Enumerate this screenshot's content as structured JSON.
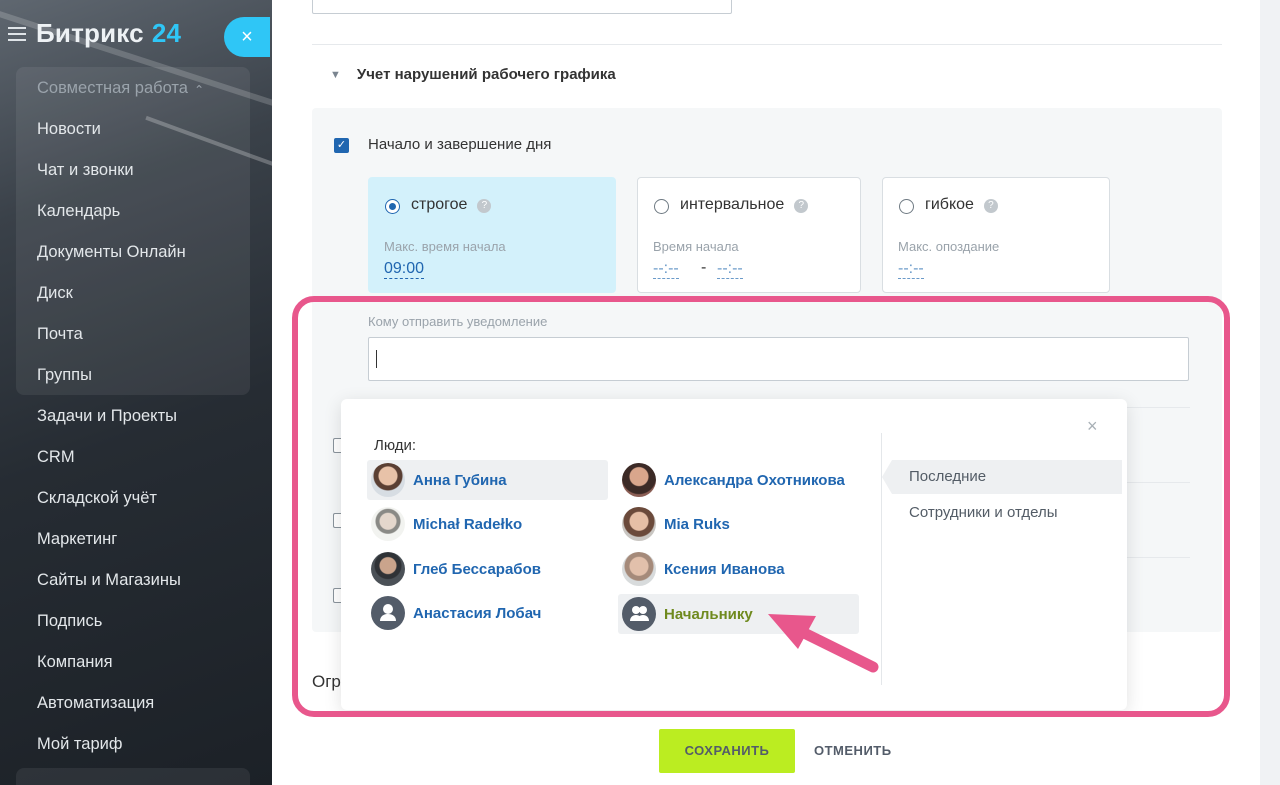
{
  "sidebar": {
    "logo": "Битрикс",
    "logo_num": "24",
    "close_icon": "×",
    "group_title": "Совместная работа",
    "items": [
      {
        "label": "Новости"
      },
      {
        "label": "Чат и звонки"
      },
      {
        "label": "Календарь"
      },
      {
        "label": "Документы Онлайн"
      },
      {
        "label": "Диск"
      },
      {
        "label": "Почта"
      },
      {
        "label": "Группы"
      },
      {
        "label": "Задачи и Проекты"
      },
      {
        "label": "CRM"
      },
      {
        "label": "Складской учёт"
      },
      {
        "label": "Маркетинг"
      },
      {
        "label": "Сайты и Магазины"
      },
      {
        "label": "Подпись"
      },
      {
        "label": "Компания"
      },
      {
        "label": "Автоматизация"
      },
      {
        "label": "Мой тариф"
      }
    ]
  },
  "section": {
    "title": "Учет нарушений рабочего графика",
    "day_checkbox_label": "Начало и завершение дня",
    "modes": [
      {
        "name": "строгое",
        "sub": "Макс. время начала",
        "value": "09:00",
        "selected": true
      },
      {
        "name": "интервальное",
        "sub": "Время начала",
        "from": "--:--",
        "sep": "-",
        "to": "--:--",
        "selected": false
      },
      {
        "name": "гибкое",
        "sub": "Макс. опоздание",
        "value": "--:--",
        "selected": false
      }
    ],
    "notify_label": "Кому отправить уведомление",
    "notify_value": "",
    "partial_text": "Огр"
  },
  "popup": {
    "close_icon": "×",
    "people_label": "Люди:",
    "people": [
      {
        "name": "Анна Губина",
        "avatar": "photo-avatar"
      },
      {
        "name": "Александра Охотникова",
        "avatar": "photo-avatar"
      },
      {
        "name": "Michał Radełko",
        "avatar": "photo-avatar"
      },
      {
        "name": "Mia Ruks",
        "avatar": "photo-avatar"
      },
      {
        "name": "Глеб Бессарабов",
        "avatar": "photo-avatar"
      },
      {
        "name": "Ксения Иванова",
        "avatar": "photo-avatar"
      },
      {
        "name": "Анастасия Лобач",
        "avatar": "user-icon"
      },
      {
        "name": "Начальнику",
        "avatar": "group-icon"
      }
    ],
    "tabs": [
      {
        "label": "Последние",
        "active": true
      },
      {
        "label": "Сотрудники и отделы",
        "active": false
      }
    ]
  },
  "footer": {
    "save_label": "СОХРАНИТЬ",
    "cancel_label": "ОТМЕНИТЬ"
  },
  "colors": {
    "accent": "#2fc6f6",
    "link": "#2066b0",
    "highlight": "#e8578c",
    "save": "#bbed21",
    "special_name": "#6f8a1e"
  }
}
